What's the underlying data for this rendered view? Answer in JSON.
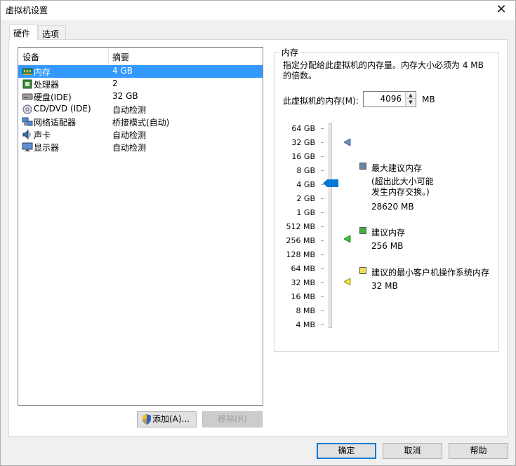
{
  "window": {
    "title": "虚拟机设置"
  },
  "tabs": [
    {
      "label": "硬件"
    },
    {
      "label": "选项"
    }
  ],
  "device_list": {
    "headers": [
      "设备",
      "摘要"
    ],
    "rows": [
      {
        "name": "内存",
        "summary": "4 GB",
        "icon": "memory-icon"
      },
      {
        "name": "处理器",
        "summary": "2",
        "icon": "processor-icon"
      },
      {
        "name": "硬盘(IDE)",
        "summary": "32 GB",
        "icon": "hard-disk-icon"
      },
      {
        "name": "CD/DVD (IDE)",
        "summary": "自动检测",
        "icon": "cd-dvd-icon"
      },
      {
        "name": "网络适配器",
        "summary": "桥接模式(自动)",
        "icon": "network-adapter-icon"
      },
      {
        "name": "声卡",
        "summary": "自动检测",
        "icon": "sound-card-icon"
      },
      {
        "name": "显示器",
        "summary": "自动检测",
        "icon": "display-icon"
      }
    ]
  },
  "list_buttons": {
    "add": "添加(A)...",
    "remove": "移除(R)"
  },
  "memory": {
    "group_title": "内存",
    "description": "指定分配给此虚拟机的内存量。内存大小必须为 4 MB 的倍数。",
    "field_label": "此虚拟机的内存(M):",
    "value": "4096",
    "unit": "MB",
    "scale": [
      "64 GB",
      "32 GB",
      "16 GB",
      "8 GB",
      "4 GB",
      "2 GB",
      "1 GB",
      "512 MB",
      "256 MB",
      "128 MB",
      "64 MB",
      "32 MB",
      "16 MB",
      "8 MB",
      "4 MB"
    ],
    "current_level": "4 GB",
    "legend": {
      "max": {
        "label": "最大建议内存",
        "note_line1": "(超出此大小可能",
        "note_line2": "发生内存交换。)",
        "value": "28620 MB",
        "color": "#6a84a8",
        "level": "32 GB"
      },
      "recommended": {
        "label": "建议内存",
        "value": "256 MB",
        "color": "#3cb43c",
        "level": "256 MB"
      },
      "min": {
        "label": "建议的最小客户机操作系统内存",
        "value": "32 MB",
        "color": "#f0e050",
        "level": "32 MB"
      }
    }
  },
  "footer_buttons": {
    "ok": "确定",
    "cancel": "取消",
    "help": "帮助"
  }
}
